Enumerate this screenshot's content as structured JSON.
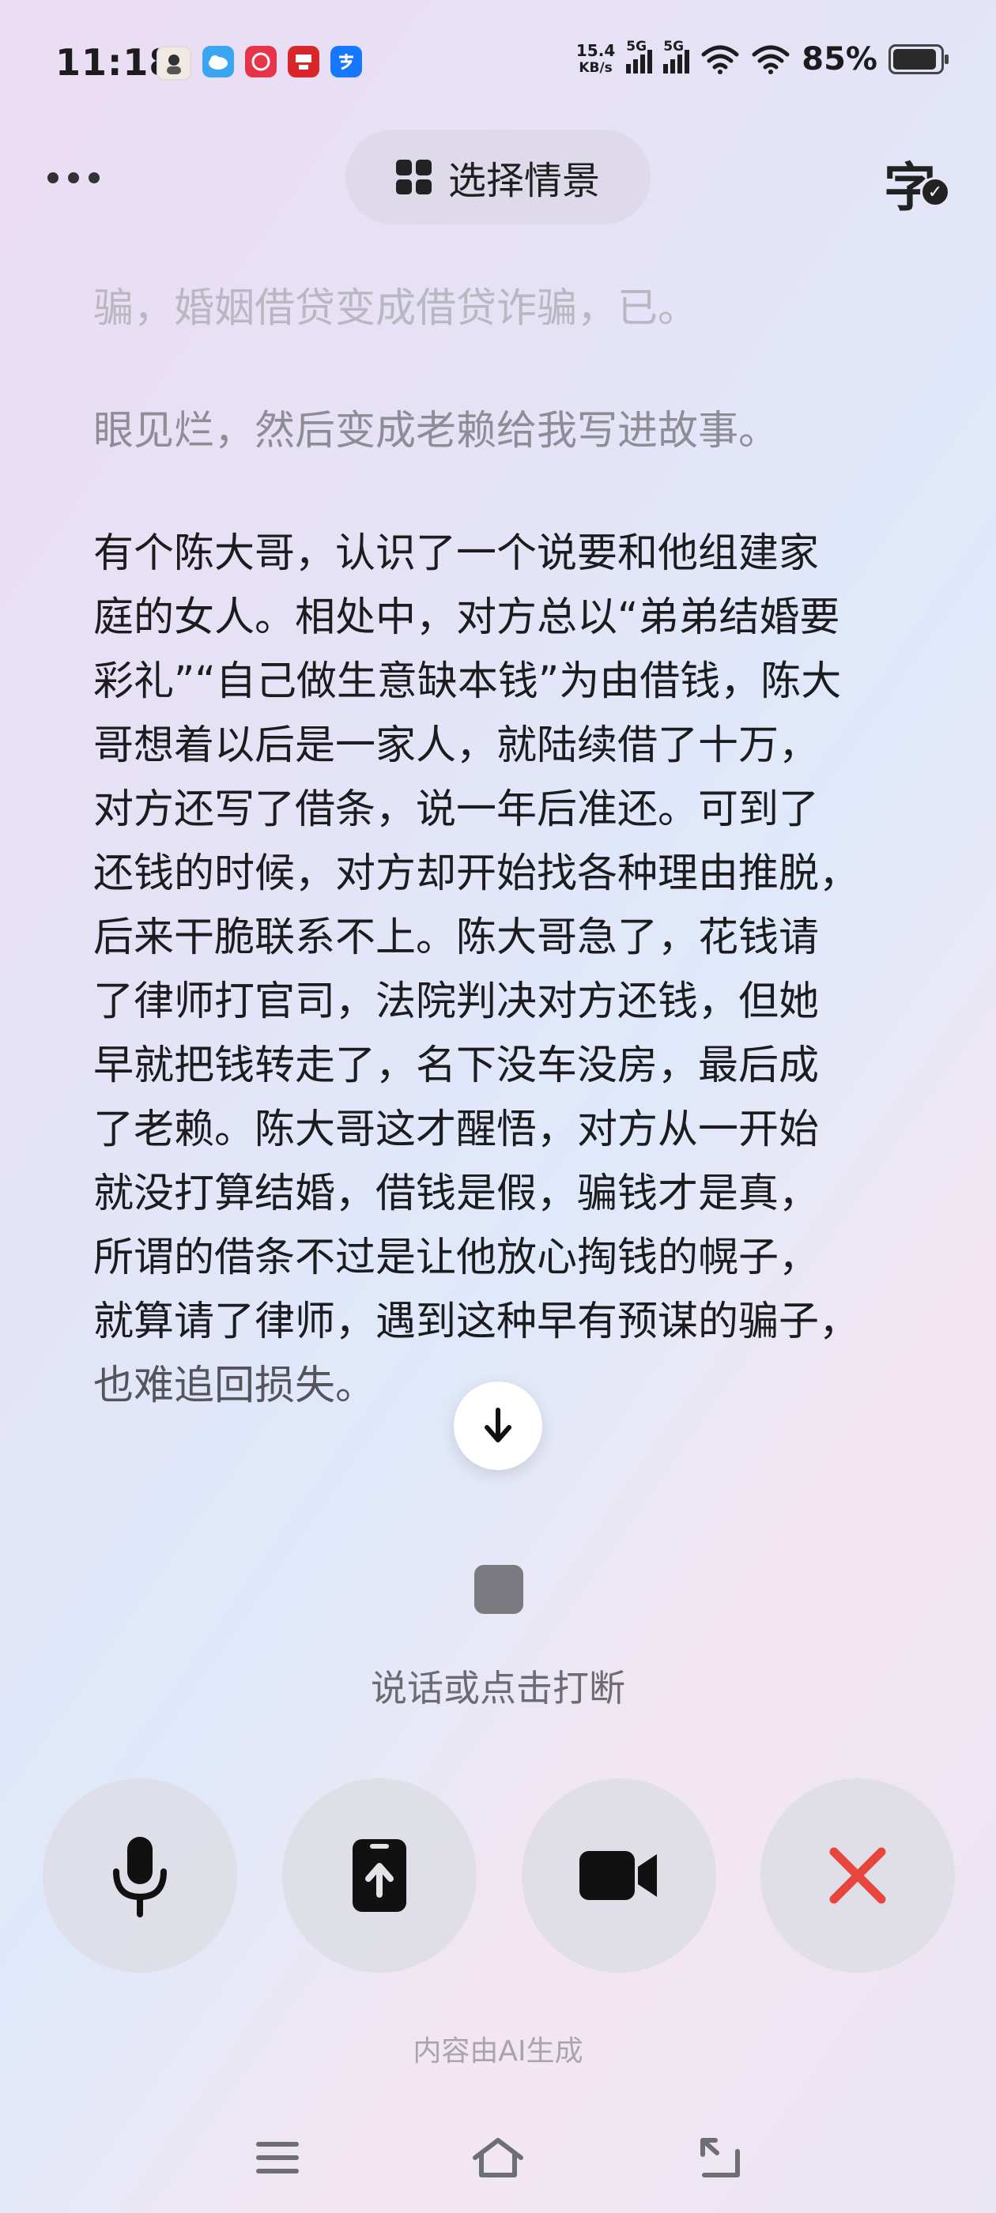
{
  "status_bar": {
    "time": "11:18",
    "net_speed_value": "15.4",
    "net_speed_unit": "KB/s",
    "sim1_label": "5G",
    "sim2_label": "5G",
    "battery_percent": "85%",
    "battery_level": 0.85,
    "notification_icons": [
      "avatar-app-icon",
      "cloud-app-icon",
      "red-app-icon",
      "news-app-icon",
      "alipay-icon"
    ]
  },
  "header": {
    "scenario_label": "选择情景",
    "font_icon_glyph": "字"
  },
  "transcript": {
    "faded_line_1": "骗，婚姻借贷变成借贷诈骗，已。",
    "faded_line_2": "眼见烂，然后变成老赖给我写进故事。",
    "main_lines": [
      "有个陈大哥，认识了一个说要和他组建家",
      "庭的女人。相处中，对方总以“弟弟结婚要",
      "彩礼”“自己做生意缺本钱”为由借钱，陈大",
      "哥想着以后是一家人，就陆续借了十万，",
      "对方还写了借条，说一年后准还。可到了",
      "还钱的时候，对方却开始找各种理由推脱，",
      "后来干脆联系不上。陈大哥急了，花钱请",
      "了律师打官司，法院判决对方还钱，但她",
      "早就把钱转走了，名下没车没房，最后成",
      "了老赖。陈大哥这才醒悟，对方从一开始",
      "就没打算结婚，借钱是假，骗钱才是真，",
      "所谓的借条不过是让他放心掏钱的幌子，",
      "就算请了律师，遇到这种早有预谋的骗子，"
    ],
    "last_line": "也难追回损失。"
  },
  "voice": {
    "hint": "说话或点击打断"
  },
  "controls": {
    "accent_red": "#e8453c"
  },
  "footer": {
    "ai_note": "内容由AI生成"
  },
  "colors": {
    "text_primary": "#1c1c1e",
    "text_faded": "#b9b7bf",
    "stop_square": "#7b7a80"
  }
}
